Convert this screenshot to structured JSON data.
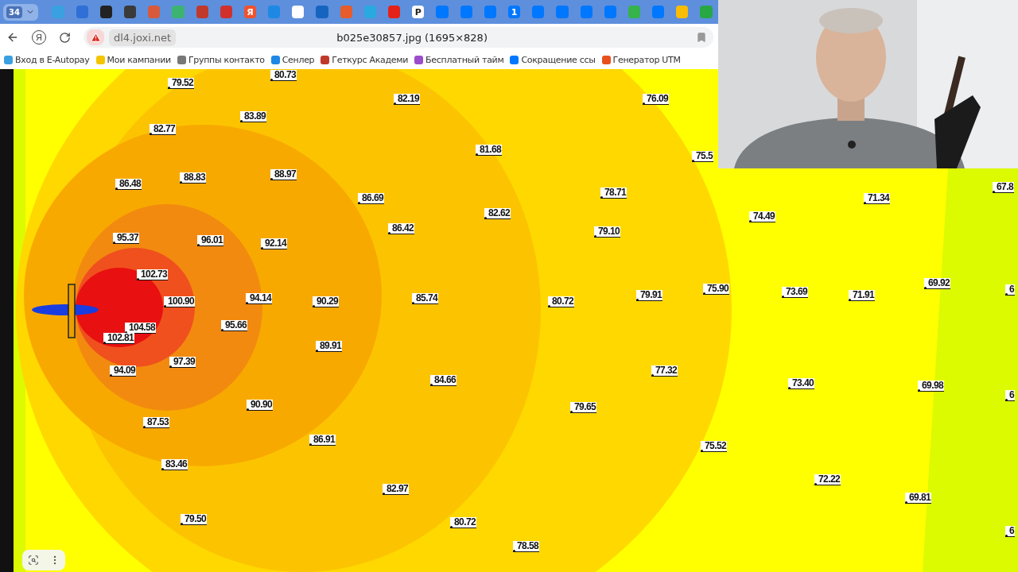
{
  "browser": {
    "tab_strip": {
      "tab_count": "34",
      "tabs": [
        {
          "color": "#3aa0e0"
        },
        {
          "color": "#2f6fd6"
        },
        {
          "color": "#222222"
        },
        {
          "color": "#3a3a3a"
        },
        {
          "color": "#d85a3a"
        },
        {
          "color": "#3cb371"
        },
        {
          "color": "#c0392b"
        },
        {
          "color": "#d0312d"
        },
        {
          "color": "#f0522d",
          "glyph": "Я"
        },
        {
          "color": "#1e88e5"
        },
        {
          "color": "#ffffff"
        },
        {
          "color": "#1565c0"
        },
        {
          "color": "#e65c2a"
        },
        {
          "color": "#2aa8e0"
        },
        {
          "color": "#e62117"
        },
        {
          "color": "#ffffff",
          "glyph": "P"
        },
        {
          "color": "#0077ff"
        },
        {
          "color": "#0077ff"
        },
        {
          "color": "#0077ff"
        },
        {
          "color": "#0077ff",
          "glyph": "1"
        },
        {
          "color": "#0077ff"
        },
        {
          "color": "#0077ff"
        },
        {
          "color": "#0077ff"
        },
        {
          "color": "#0077ff"
        },
        {
          "color": "#36b34a"
        },
        {
          "color": "#0077ff"
        },
        {
          "color": "#fbbc04"
        },
        {
          "color": "#27a844"
        }
      ]
    },
    "toolbar": {
      "home_glyph": "Я",
      "domain": "dl4.joxi.net",
      "page_title": "b025e30857.jpg (1695×828)"
    },
    "bookmarks": [
      {
        "label": "Вход в E-Autopay",
        "color": "#3aa0e0"
      },
      {
        "label": "Мои кампании",
        "color": "#f5c400"
      },
      {
        "label": "Группы контакто",
        "color": "#777777"
      },
      {
        "label": "Сенлер",
        "color": "#1e88e5"
      },
      {
        "label": "Геткурс Академи",
        "color": "#c0392b"
      },
      {
        "label": "Бесплатный тайм",
        "color": "#9c4dcc"
      },
      {
        "label": "Сокращение ссы",
        "color": "#0077ff"
      },
      {
        "label": "Генератор UTM",
        "color": "#e8501e"
      }
    ]
  },
  "map": {
    "labels": [
      "79.52",
      "80.73",
      "82.19",
      "76.09",
      "82.77",
      "83.89",
      "81.68",
      "75.5",
      "86.48",
      "88.83",
      "88.97",
      "86.69",
      "78.71",
      "82.62",
      "71.34",
      "67.8",
      "74.49",
      "86.42",
      "79.10",
      "95.37",
      "96.01",
      "92.14",
      "102.73",
      "100.90",
      "94.14",
      "90.29",
      "85.74",
      "80.72",
      "79.91",
      "75.90",
      "73.69",
      "71.91",
      "69.92",
      "6",
      "104.58",
      "95.66",
      "102.81",
      "89.91",
      "94.09",
      "97.39",
      "77.32",
      "84.66",
      "73.40",
      "69.98",
      "6",
      "79.65",
      "90.90",
      "87.53",
      "86.91",
      "75.52",
      "83.46",
      "82.97",
      "72.22",
      "69.81",
      "79.50",
      "80.72",
      "78.58",
      "6"
    ]
  }
}
